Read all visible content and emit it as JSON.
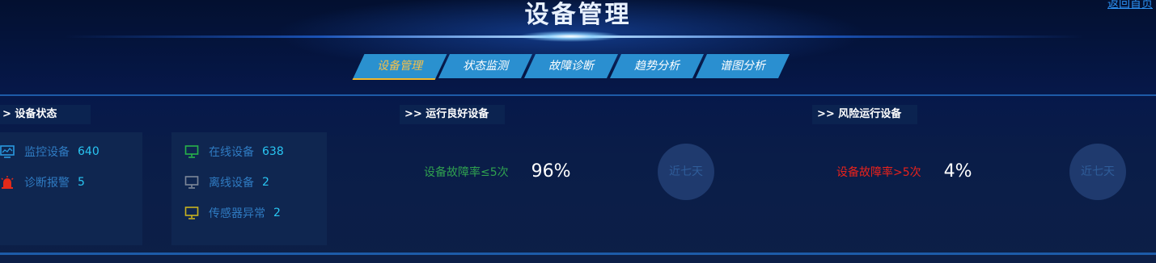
{
  "header": {
    "title": "设备管理",
    "back_link": "返回首页"
  },
  "tabs": [
    {
      "label": "设备管理",
      "active": true
    },
    {
      "label": "状态监测",
      "active": false
    },
    {
      "label": "故障诊断",
      "active": false
    },
    {
      "label": "趋势分析",
      "active": false
    },
    {
      "label": "谱图分析",
      "active": false
    }
  ],
  "device_status": {
    "title": "> 设备状态",
    "left": [
      {
        "label": "监控设备",
        "value": "640",
        "icon": "monitor-icon"
      },
      {
        "label": "诊断报警",
        "value": "5",
        "icon": "alarm-icon"
      }
    ],
    "right": [
      {
        "label": "在线设备",
        "value": "638",
        "icon": "monitor-online-icon"
      },
      {
        "label": "离线设备",
        "value": "2",
        "icon": "monitor-offline-icon"
      },
      {
        "label": "传感器异常",
        "value": "2",
        "icon": "monitor-sensor-icon"
      }
    ]
  },
  "good_devices": {
    "title": ">> 运行良好设备",
    "label": "设备故障率≤5次",
    "percent": "96%",
    "button": "近七天"
  },
  "risk_devices": {
    "title": ">> 风险运行设备",
    "label": "设备故障率>5次",
    "percent": "4%",
    "button": "近七天"
  },
  "colors": {
    "good_label": "#2fa04f",
    "risk_label": "#e8221c",
    "icon_online": "#27b24a",
    "icon_offline": "#7d8799",
    "icon_sensor": "#c9b31e",
    "icon_monitor": "#2a9ae0",
    "icon_alarm": "#e22a1a"
  }
}
